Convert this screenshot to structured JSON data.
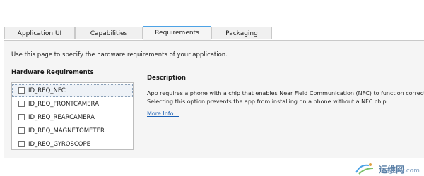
{
  "tabs": [
    {
      "label": "Application UI",
      "active": false
    },
    {
      "label": "Capabilities",
      "active": false
    },
    {
      "label": "Requirements",
      "active": true
    },
    {
      "label": "Packaging",
      "active": false
    }
  ],
  "intro_text": "Use this page to specify the hardware requirements of your application.",
  "hardware": {
    "heading": "Hardware Requirements",
    "items": [
      {
        "label": "ID_REQ_NFC",
        "checked": false,
        "selected": true
      },
      {
        "label": "ID_REQ_FRONTCAMERA",
        "checked": false,
        "selected": false
      },
      {
        "label": "ID_REQ_REARCAMERA",
        "checked": false,
        "selected": false
      },
      {
        "label": "ID_REQ_MAGNETOMETER",
        "checked": false,
        "selected": false
      },
      {
        "label": "ID_REQ_GYROSCOPE",
        "checked": false,
        "selected": false
      }
    ]
  },
  "description": {
    "heading": "Description",
    "line1": "App requires a phone with a chip that enables Near Field Communication (NFC) to function correctly.",
    "line2": "Selecting this option prevents the app from installing on a phone without a NFC chip.",
    "more_link": "More Info..."
  },
  "watermark": {
    "cn": "运维网",
    "en": "iyunv.com"
  },
  "colors": {
    "active_tab_border": "#4da3e6",
    "panel_bg": "#f5f5f5",
    "link": "#1a5fb4"
  }
}
